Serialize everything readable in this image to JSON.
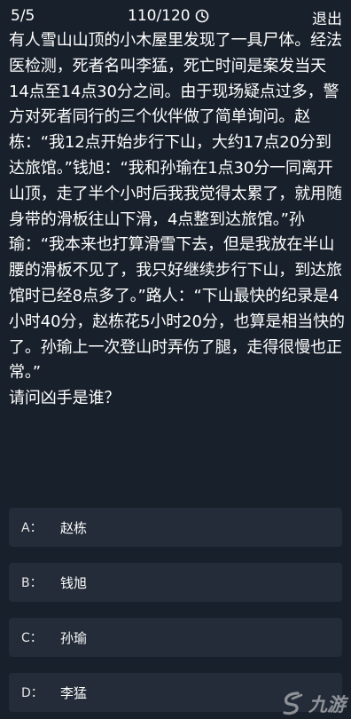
{
  "header": {
    "progress": "5/5",
    "timer": "110/120",
    "timer_icon": "clock-icon",
    "exit_label": "退出"
  },
  "question": {
    "text": "有人雪山山顶的小木屋里发现了一具尸体。经法医检测，死者名叫李猛，死亡时间是案发当天14点至14点30分之间。由于现场疑点过多，警方对死者同行的三个伙伴做了简单询问。赵栋：“我12点开始步行下山，大约17点20分到达旅馆。”钱旭：“我和孙瑜在1点30分一同离开山顶，走了半个小时后我我觉得太累了，就用随身带的滑板往山下滑，4点整到达旅馆。”孙瑜：“我本来也打算滑雪下去，但是我放在半山腰的滑板不见了，我只好继续步行下山，到达旅馆时已经8点多了。”路人：“下山最快的纪录是4小时40分，赵栋花5小时20分，也算是相当快的了。孙瑜上一次登山时弄伤了腿，走得很慢也正常。”\n请问凶手是谁？"
  },
  "options": [
    {
      "letter": "A：",
      "text": "赵栋"
    },
    {
      "letter": "B：",
      "text": "钱旭"
    },
    {
      "letter": "C：",
      "text": "孙瑜"
    },
    {
      "letter": "D：",
      "text": "李猛"
    }
  ],
  "watermark": {
    "icon": "jiuyou-logo-icon",
    "text": "九游"
  }
}
